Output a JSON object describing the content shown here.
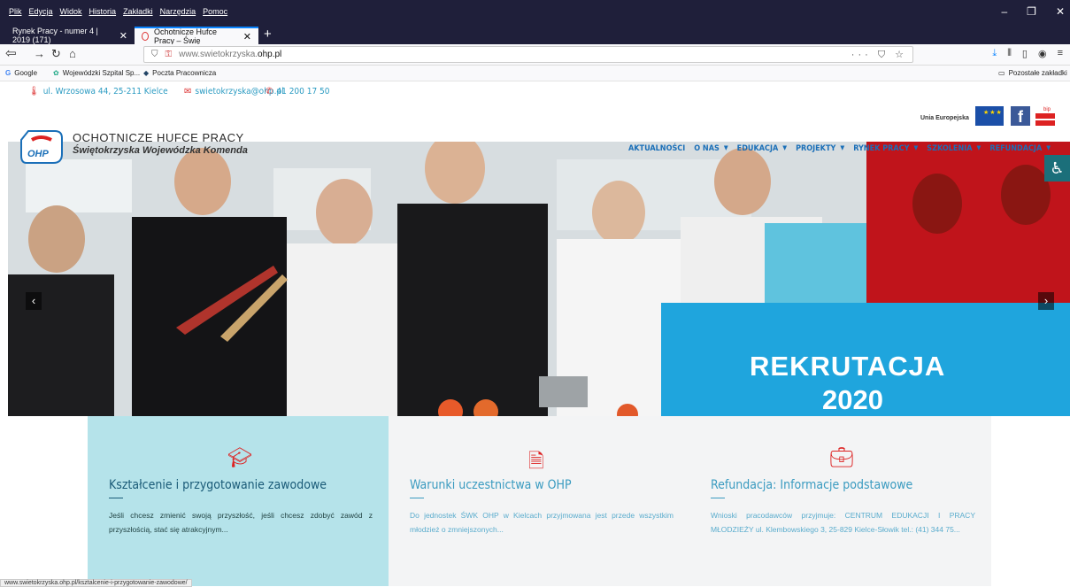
{
  "browser": {
    "menu": [
      "Plik",
      "Edycja",
      "Widok",
      "Historia",
      "Zakładki",
      "Narzędzia",
      "Pomoc"
    ],
    "tabs": [
      {
        "label": "Rynek Pracy - numer 4 | 2019 (171)"
      },
      {
        "label": "Ochotnicze Hufce Pracy – Świę"
      }
    ],
    "url_prefix": "www.swietokrzyska.",
    "url_domain": "ohp.pl",
    "bookmarks": [
      "Google",
      "Wojewódzki Szpital Sp...",
      "Poczta Pracownicza"
    ],
    "other_bookmarks": "Pozostałe zakładki",
    "status_url": "www.swietokrzyska.ohp.pl/ksztalcenie-i-przygotowanie-zawodowe/"
  },
  "contact": {
    "address": "ul. Wrzosowa 44, 25-211 Kielce",
    "email": "swietokrzyska@ohp.pl",
    "phone": "41 200 17 50"
  },
  "eu_label": "Unia Europejska",
  "brand": {
    "line1": "OCHOTNICZE HUFCE PRACY",
    "line2": "Świętokrzyska Wojewódzka Komenda",
    "logo_text": "OHP"
  },
  "nav": [
    "AKTUALNOŚCI",
    "O NAS",
    "EDUKACJA",
    "PROJEKTY",
    "RYNEK PRACY",
    "SZKOLENIA",
    "REFUNDACJA"
  ],
  "hero": {
    "line1": "REKRUTACJA",
    "line2": "2020"
  },
  "cards": [
    {
      "title": "Kształcenie i przygotowanie zawodowe",
      "text": "Jeśli chcesz zmienić swoją przyszłość, jeśli chcesz zdobyć zawód z przyszłością, stać się atrakcyjnym..."
    },
    {
      "title": "Warunki uczestnictwa w OHP",
      "text": "Do jednostek ŚWK OHP w Kielcach przyjmowana jest przede wszystkim młodzież o zmniejszonych..."
    },
    {
      "title": "Refundacja: Informacje podstawowe",
      "text": "Wnioski pracodawców przyjmuje: CENTRUM EDUKACJI I PRACY MŁODZIEŻY ul. Klembowskiego 3, 25-829 Kielce-Słowik tel.: (41) 344 75..."
    }
  ],
  "colors": {
    "accent_blue": "#1a6fb8",
    "brand_red": "#dd2222",
    "card_highlight": "#b5e3ea"
  }
}
